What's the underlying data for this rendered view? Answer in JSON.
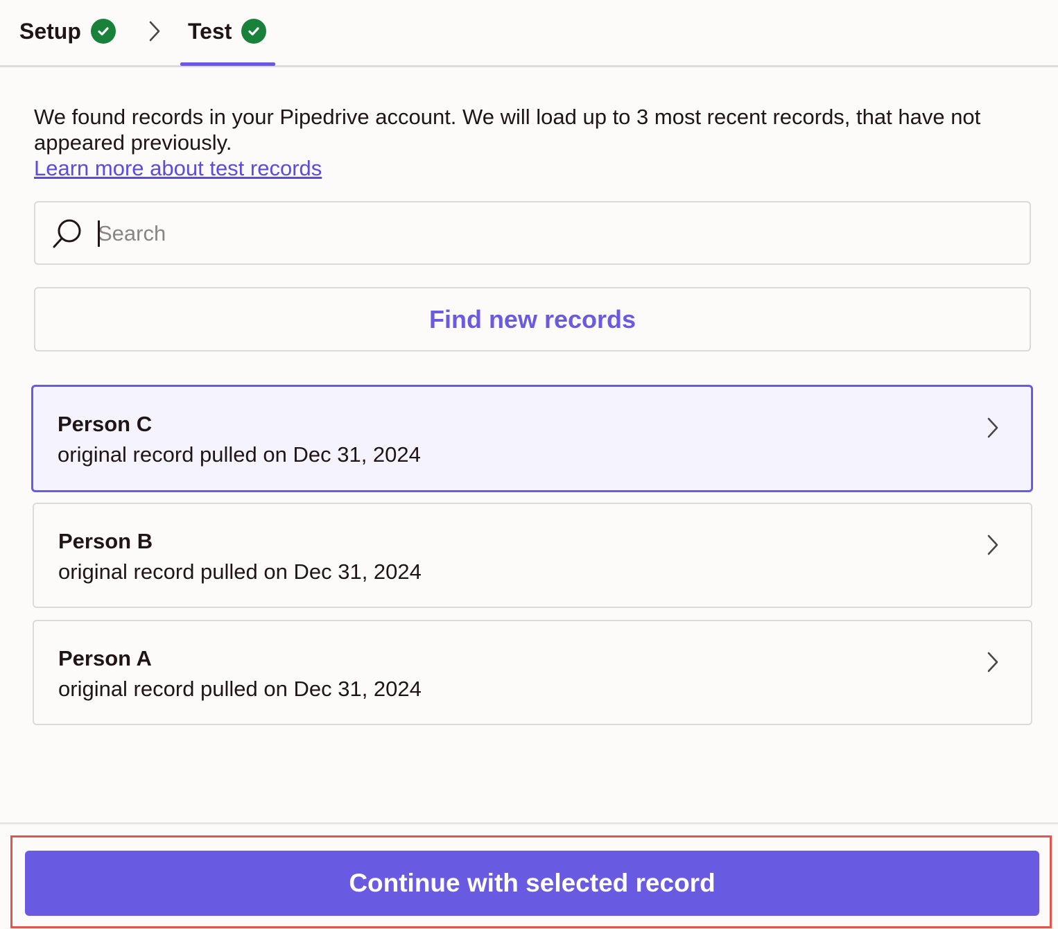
{
  "tabs": {
    "setup_label": "Setup",
    "test_label": "Test",
    "active": "Test",
    "check_icon": "check-circle-icon",
    "separator_icon": "chevron-right-icon"
  },
  "intro": {
    "text": "We found records in your Pipedrive account. We will load up to 3 most recent records, that have not appeared previously.",
    "link_label": "Learn more about test records"
  },
  "search": {
    "placeholder": "Search",
    "value": "",
    "icon": "search-icon"
  },
  "find_button": {
    "label": "Find new records"
  },
  "records": [
    {
      "name": "Person C",
      "subtitle": "original record pulled on Dec 31, 2024",
      "selected": true
    },
    {
      "name": "Person B",
      "subtitle": "original record pulled on Dec 31, 2024",
      "selected": false
    },
    {
      "name": "Person A",
      "subtitle": "original record pulled on Dec 31, 2024",
      "selected": false
    }
  ],
  "footer": {
    "continue_label": "Continue with selected record"
  },
  "colors": {
    "accent": "#6a5ae0",
    "success": "#18813a",
    "highlight": "#e6534b",
    "link": "#5b4bdf"
  }
}
